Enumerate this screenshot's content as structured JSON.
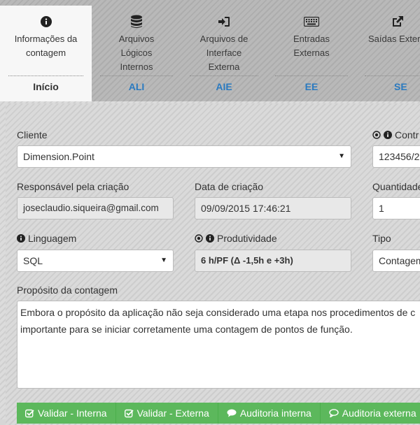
{
  "tabs": [
    {
      "id": "info",
      "title": "Informações da contagem",
      "abbr": "Início",
      "icon": "info-icon",
      "active": true
    },
    {
      "id": "ali",
      "title": "Arquivos Lógicos Internos",
      "abbr": "ALI",
      "icon": "database-icon"
    },
    {
      "id": "aie",
      "title": "Arquivos de Interface Externa",
      "abbr": "AIE",
      "icon": "sign-in-icon"
    },
    {
      "id": "ee",
      "title": "Entradas Externas",
      "abbr": "EE",
      "icon": "keyboard-icon"
    },
    {
      "id": "se",
      "title": "Saídas Extern",
      "abbr": "SE",
      "icon": "external-link-icon"
    }
  ],
  "form": {
    "cliente_label": "Cliente",
    "cliente_value": "Dimension.Point",
    "contrato_label": "Contr",
    "contrato_value": "123456/2",
    "responsavel_label": "Responsável pela criação",
    "responsavel_value": "joseclaudio.siqueira@gmail.com",
    "data_label": "Data de criação",
    "data_value": "09/09/2015 17:46:21",
    "quantidade_label": "Quantidade",
    "quantidade_value": "1",
    "linguagem_label": "Linguagem",
    "linguagem_value": "SQL",
    "produtividade_label": "Produtividade",
    "produtividade_value": "6 h/PF (Δ -1,5h e +3h)",
    "tipo_label": "Tipo",
    "tipo_value": "Contagem",
    "proposito_label": "Propósito da contagem",
    "proposito_line1": "Embora o propósito da aplicação não seja considerado uma etapa nos procedimentos de c",
    "proposito_line2": "importante para se iniciar corretamente uma contagem de pontos de função."
  },
  "buttons": {
    "validar_interna": "Validar - Interna",
    "validar_externa": "Validar - Externa",
    "auditoria_interna": "Auditoria interna",
    "auditoria_externa": "Auditoria externa"
  },
  "colors": {
    "accent": "#2a7ac0",
    "success": "#5cb85c"
  }
}
